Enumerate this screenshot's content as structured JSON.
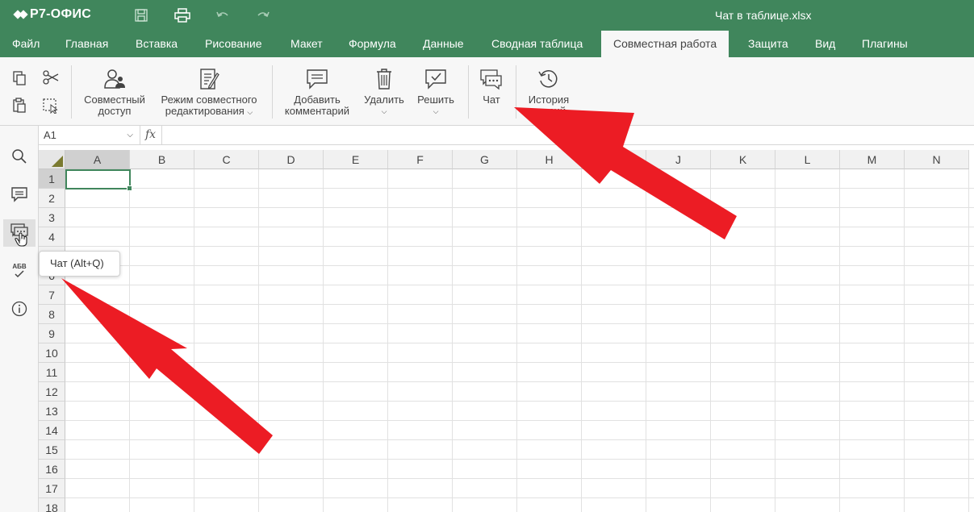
{
  "app": {
    "logo_text": "Р7-ОФИС",
    "document_title": "Чат в таблице.xlsx"
  },
  "titlebar": {
    "icons": [
      "save-icon",
      "print-icon",
      "undo-icon",
      "redo-icon"
    ]
  },
  "menu": {
    "tabs": [
      {
        "label": "Файл"
      },
      {
        "label": "Главная"
      },
      {
        "label": "Вставка"
      },
      {
        "label": "Рисование"
      },
      {
        "label": "Макет"
      },
      {
        "label": "Формула"
      },
      {
        "label": "Данные"
      },
      {
        "label": "Сводная таблица"
      },
      {
        "label": "Совместная работа",
        "active": true
      },
      {
        "label": "Защита"
      },
      {
        "label": "Вид"
      },
      {
        "label": "Плагины"
      }
    ]
  },
  "ribbon": {
    "co_access": {
      "line1": "Совместный",
      "line2": "доступ"
    },
    "co_edit_mode": {
      "line1": "Режим совместного",
      "line2": "редактирования"
    },
    "add_comment": {
      "line1": "Добавить",
      "line2": "комментарий"
    },
    "delete": {
      "label": "Удалить"
    },
    "resolve": {
      "label": "Решить"
    },
    "chat": {
      "label": "Чат"
    },
    "version_history": {
      "line1": "История",
      "line2": "версий"
    }
  },
  "formula_bar": {
    "cell_ref": "A1",
    "fx_label": "fx",
    "value": ""
  },
  "sheet": {
    "columns": [
      "A",
      "B",
      "C",
      "D",
      "E",
      "F",
      "G",
      "H",
      "I",
      "J",
      "K",
      "L",
      "M",
      "N"
    ],
    "rows": [
      "1",
      "2",
      "3",
      "4",
      "5",
      "6",
      "7",
      "8",
      "9",
      "10",
      "11",
      "12",
      "13",
      "14",
      "15",
      "16",
      "17",
      "18"
    ],
    "selected_cell": "A1"
  },
  "left_rail": {
    "icons": [
      "search-icon",
      "comments-icon",
      "chat-icon",
      "spellcheck-icon",
      "info-icon"
    ],
    "spellcheck_text": "АБВ",
    "active": "chat-icon"
  },
  "tooltip": {
    "text": "Чат (Alt+Q)"
  },
  "colors": {
    "brand": "#40865c",
    "arrow": "#ec1c24",
    "ribbon_bg": "#f7f7f7"
  }
}
